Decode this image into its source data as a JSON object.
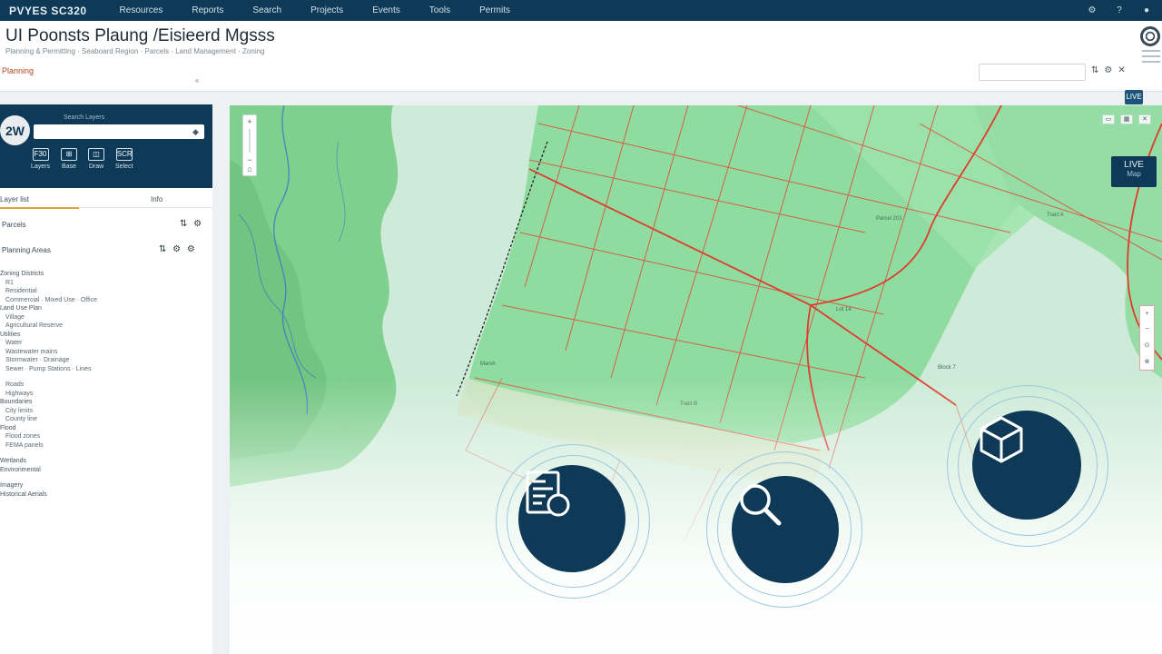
{
  "nav": {
    "brand": "PVYES SC320",
    "links": [
      "Resources",
      "Reports",
      "Search",
      "Projects",
      "Events",
      "Tools",
      "Permits"
    ],
    "right_icons": [
      "gear-icon",
      "help-icon",
      "user-icon"
    ],
    "right_glyphs": [
      "⚙",
      "?",
      "●"
    ]
  },
  "header": {
    "title": "UI Poonsts  Plaung /Eisieerd Mgsss",
    "subtitle": "Planning & Permitting · Seaboard Region · Parcels · Land Management · Zoning",
    "breadcrumb": "Planning",
    "search_placeholder": "",
    "icons": [
      "⇅",
      "⚙",
      "✕"
    ],
    "user_badge": "LIVE"
  },
  "sidebar": {
    "avatar": "2W",
    "panel_title": "Search Layers",
    "search_placeholder": "",
    "tools": [
      {
        "icon": "F30",
        "label": "Layers"
      },
      {
        "icon": "⊞",
        "label": "Base"
      },
      {
        "icon": "◫",
        "label": "Draw"
      },
      {
        "icon": "SCR",
        "label": "Select"
      }
    ],
    "tabs": [
      "Layer list",
      "Info"
    ],
    "rows": [
      {
        "label": "Parcels",
        "ctrl": "⇅ ⚙"
      },
      {
        "label": "Planning Areas",
        "ctrl": "⇅ ⚙ ⚙"
      }
    ],
    "tree": [
      {
        "level": 0,
        "label": "Zoning Districts"
      },
      {
        "level": 1,
        "label": "R1"
      },
      {
        "level": 1,
        "label": "Residential"
      },
      {
        "level": 1,
        "label": "Commercial · Mixed Use · Office"
      },
      {
        "level": 0,
        "label": "Land Use Plan"
      },
      {
        "level": 1,
        "label": "Village"
      },
      {
        "level": 1,
        "label": "Agricultural Reserve"
      },
      {
        "level": 0,
        "label": "Utilities"
      },
      {
        "level": 1,
        "label": "Water"
      },
      {
        "level": 1,
        "label": "Wastewater mains"
      },
      {
        "level": 1,
        "label": "Stormwater · Drainage"
      },
      {
        "level": 1,
        "label": "Sewer · Pump Stations · Lines"
      },
      {
        "gap": true
      },
      {
        "level": 1,
        "label": "Roads"
      },
      {
        "level": 1,
        "label": "Highways"
      },
      {
        "level": 0,
        "label": "Boundaries"
      },
      {
        "level": 1,
        "label": "City limits"
      },
      {
        "level": 1,
        "label": "County line"
      },
      {
        "level": 0,
        "label": "Flood"
      },
      {
        "level": 1,
        "label": "Flood zones"
      },
      {
        "level": 1,
        "label": "FEMA panels"
      },
      {
        "gap": true
      },
      {
        "level": 0,
        "label": "Wetlands"
      },
      {
        "level": 0,
        "label": "Environmental"
      },
      {
        "gap": true
      },
      {
        "level": 0,
        "label": "Imagery"
      },
      {
        "level": 0,
        "label": "Historical Aerials"
      }
    ]
  },
  "map": {
    "zoom": {
      "in": "+",
      "out": "−",
      "home": "⌂"
    },
    "top_controls": [
      "▭",
      "▦",
      "✕"
    ],
    "legend": {
      "line1": "LIVE",
      "line2": "Map"
    },
    "side_controls": [
      "+",
      "−",
      "⊙",
      "⊕"
    ],
    "labels": [
      "Parcel 201",
      "Tract A",
      "Lot 14",
      "Block 7",
      "Tract B",
      "Marsh"
    ],
    "actions": [
      {
        "name": "document-search",
        "icon": "document-search-icon"
      },
      {
        "name": "search",
        "icon": "magnifier-icon"
      },
      {
        "name": "3d-layers",
        "icon": "cube-icon"
      }
    ],
    "colors": {
      "parcel_line": "#e24a3b",
      "land": "#8fdca0",
      "water": "#bfe6cf",
      "action": "#0f3a57"
    }
  }
}
